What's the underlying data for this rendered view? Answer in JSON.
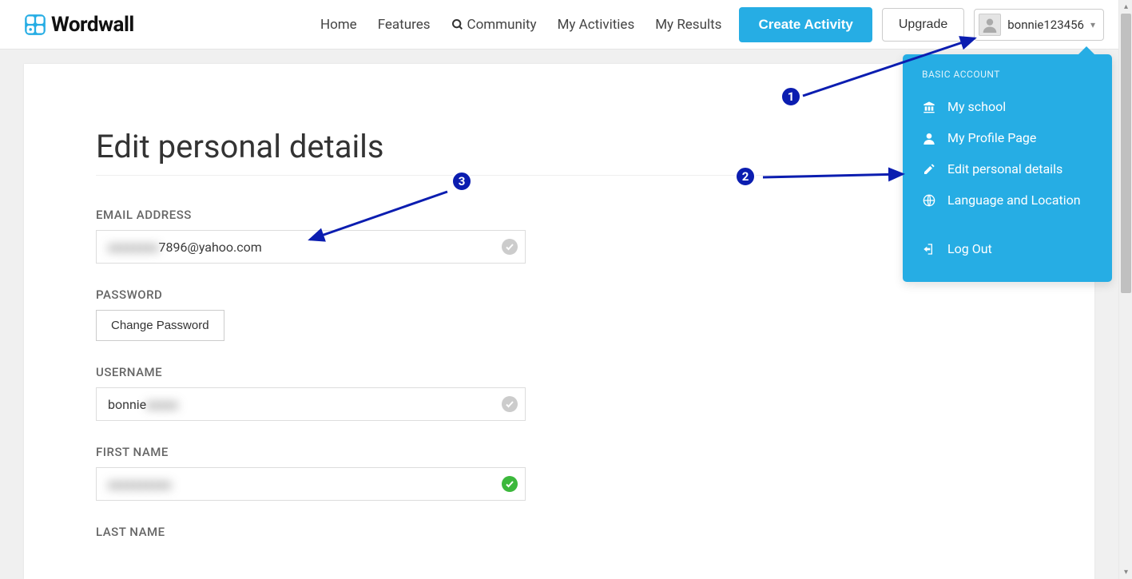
{
  "header": {
    "brand": "Wordwall",
    "nav": {
      "home": "Home",
      "features": "Features",
      "community": "Community",
      "my_activities": "My Activities",
      "my_results": "My Results"
    },
    "create_button": "Create Activity",
    "upgrade_button": "Upgrade",
    "username": "bonnie123456"
  },
  "dropdown": {
    "account_type": "BASIC ACCOUNT",
    "items": {
      "school": "My school",
      "profile": "My Profile Page",
      "edit_details": "Edit personal details",
      "language": "Language and Location",
      "logout": "Log Out"
    }
  },
  "page": {
    "title": "Edit personal details",
    "labels": {
      "email": "EMAIL ADDRESS",
      "password": "PASSWORD",
      "username": "USERNAME",
      "first_name": "FIRST NAME",
      "last_name": "LAST NAME"
    },
    "values": {
      "email_hidden": "xxxxxxxx",
      "email_suffix": "7896@yahoo.com",
      "username_prefix": "bonnie",
      "username_hidden": "xxxxx",
      "first_name_hidden": "xxxxxxxxxx"
    },
    "buttons": {
      "change_password": "Change Password"
    }
  },
  "annotations": {
    "b1": "1",
    "b2": "2",
    "b3": "3"
  }
}
